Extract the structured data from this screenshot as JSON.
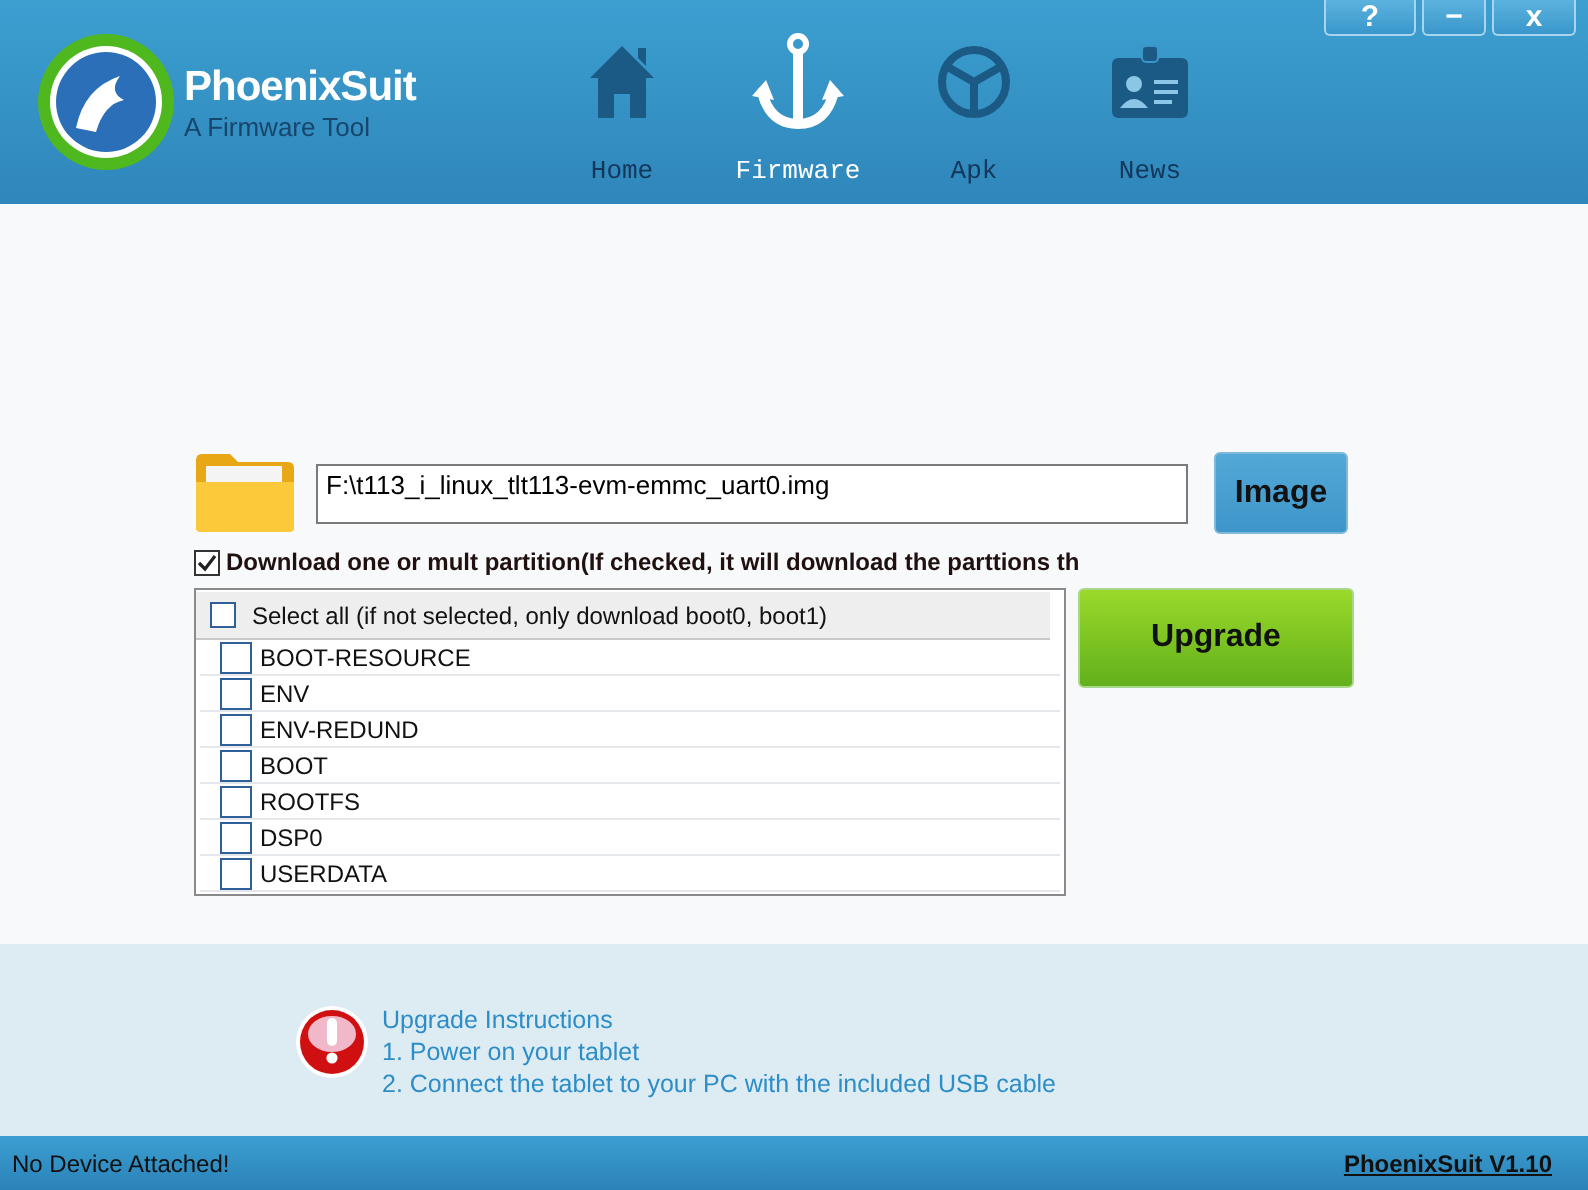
{
  "app": {
    "name": "PhoenixSuit",
    "subtitle": "A Firmware Tool"
  },
  "window_controls": [
    {
      "kind": "help",
      "label": "?"
    },
    {
      "kind": "minimize",
      "label": "−"
    },
    {
      "kind": "close",
      "label": "x"
    }
  ],
  "nav": [
    {
      "kind": "home",
      "label": "Home",
      "selected": false
    },
    {
      "kind": "firmware",
      "label": "Firmware",
      "selected": true
    },
    {
      "kind": "apk",
      "label": "Apk",
      "selected": false
    },
    {
      "kind": "news",
      "label": "News",
      "selected": false
    }
  ],
  "image_path": {
    "value": "F:\\t113_i_linux_tlt113-evm-emmc_uart0.img"
  },
  "image_button": "Image",
  "partition_option": {
    "label": "Download one or mult partition(If checked, it will download the parttions th",
    "checked": true
  },
  "partitions": {
    "select_all": {
      "label": "Select all (if not selected, only download boot0, boot1)",
      "checked": false
    },
    "items": [
      {
        "name": "BOOT-RESOURCE",
        "checked": false
      },
      {
        "name": "ENV",
        "checked": false
      },
      {
        "name": "ENV-REDUND",
        "checked": false
      },
      {
        "name": "BOOT",
        "checked": false
      },
      {
        "name": "ROOTFS",
        "checked": false
      },
      {
        "name": "DSP0",
        "checked": false
      },
      {
        "name": "USERDATA",
        "checked": false
      }
    ]
  },
  "upgrade_button": "Upgrade",
  "instructions": {
    "title": "Upgrade Instructions",
    "steps": [
      "1. Power on your tablet",
      "2. Connect the tablet to your PC with the included USB cable"
    ]
  },
  "status_bar": {
    "message": "No Device Attached!",
    "version": "PhoenixSuit V1.10"
  }
}
